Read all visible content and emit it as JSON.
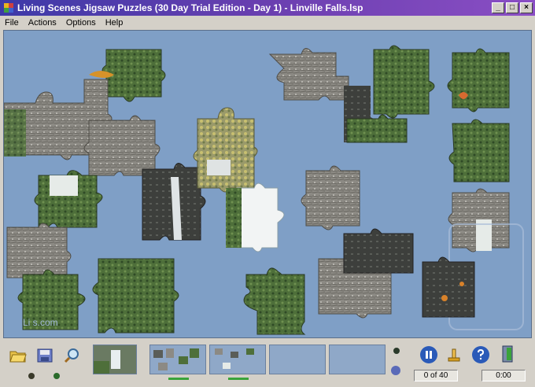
{
  "window": {
    "title": "Living Scenes Jigsaw Puzzles (30 Day Trial Edition - Day 1) - Linville Falls.lsp",
    "minimize": "_",
    "maximize": "□",
    "close": "×"
  },
  "menu": {
    "items": [
      "File",
      "Actions",
      "Options",
      "Help"
    ]
  },
  "board": {
    "background": "#7f9fc6",
    "watermark": "Li            s.com"
  },
  "status": {
    "pieces": "0 of 40",
    "time": "0:00"
  },
  "toolbar": {
    "icons": [
      "open-folder-icon",
      "save-icon",
      "magnify-icon",
      "preview-icon",
      "pause-icon",
      "hand-icon",
      "help-icon",
      "exit-icon"
    ]
  }
}
